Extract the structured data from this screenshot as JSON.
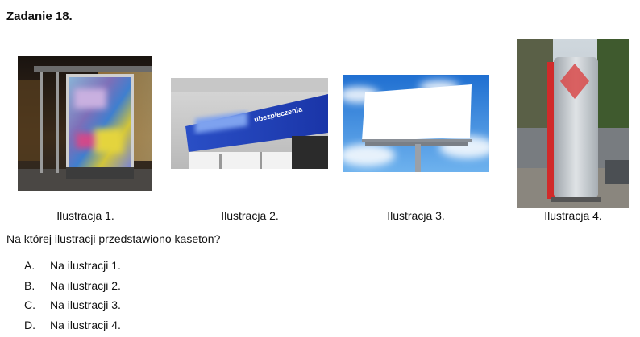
{
  "task": {
    "title": "Zadanie 18."
  },
  "illustrations": [
    {
      "caption": "Ilustracja 1."
    },
    {
      "caption": "Ilustracja 2.",
      "sign_text": "ubezpieczenia"
    },
    {
      "caption": "Ilustracja 3."
    },
    {
      "caption": "Ilustracja 4."
    }
  ],
  "question": "Na której ilustracji przedstawiono kaseton?",
  "answers": [
    {
      "letter": "A.",
      "text": "Na ilustracji 1."
    },
    {
      "letter": "B.",
      "text": "Na ilustracji 2."
    },
    {
      "letter": "C.",
      "text": "Na ilustracji 3."
    },
    {
      "letter": "D.",
      "text": "Na ilustracji 4."
    }
  ]
}
